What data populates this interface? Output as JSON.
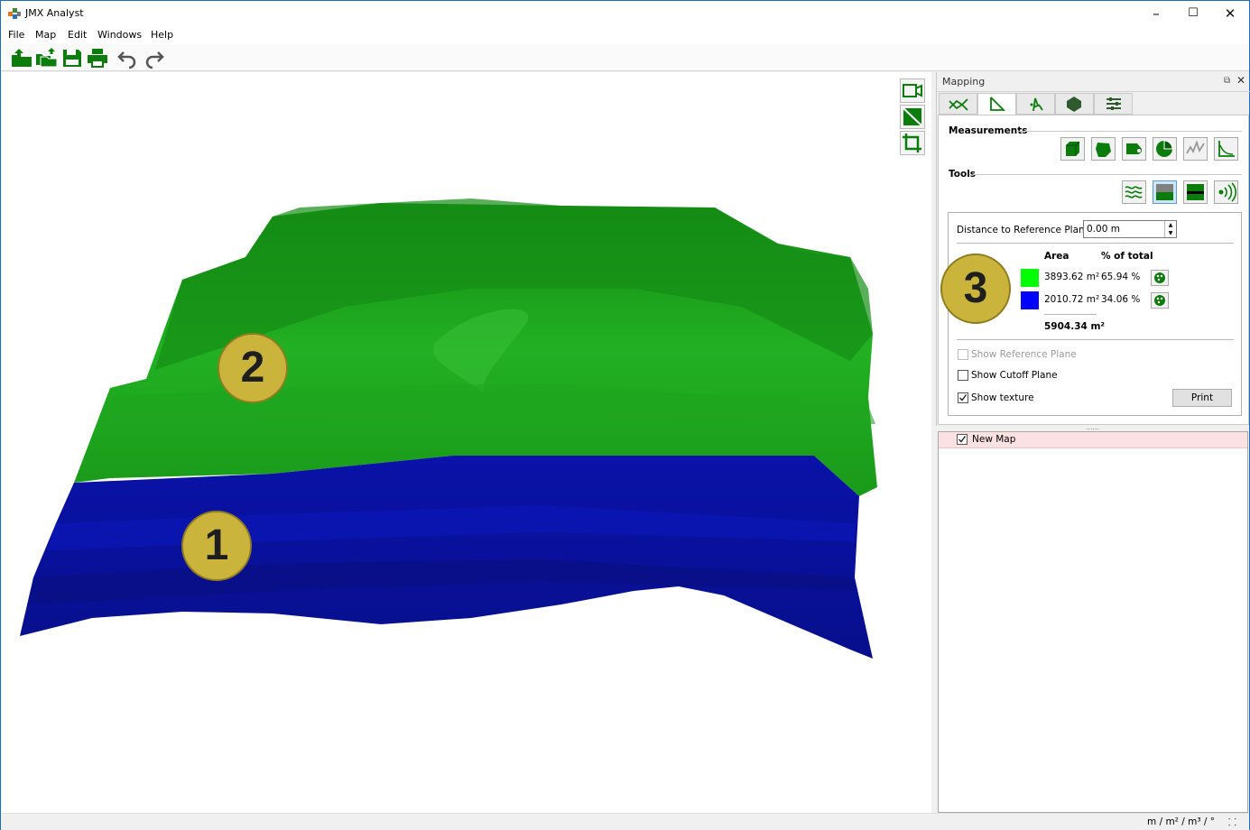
{
  "window": {
    "title": "JMX Analyst"
  },
  "menu": [
    "File",
    "Map",
    "Edit",
    "Windows",
    "Help"
  ],
  "toolbar_icons": [
    "open-folder-icon",
    "open-multiple-icon",
    "save-icon",
    "print-icon",
    "undo-icon",
    "redo-icon"
  ],
  "viewport": {
    "markers": [
      "1",
      "2",
      "3"
    ],
    "colors": {
      "above": "#1fa61f",
      "below": "#0a14b8"
    }
  },
  "mapping_panel": {
    "title": "Mapping",
    "measurements_label": "Measurements",
    "tools_label": "Tools",
    "distance_label": "Distance to Reference Plane:",
    "distance_value": "0.00 m",
    "area_header": "Area",
    "percent_header": "% of total",
    "rows": [
      {
        "color": "#00ff00",
        "area": "3893.62 m²",
        "percent": "65.94 %"
      },
      {
        "color": "#0000ff",
        "area": "2010.72 m²",
        "percent": "34.06 %"
      }
    ],
    "total": "5904.34 m²",
    "show_reference_plane": "Show Reference Plane",
    "show_cutoff_plane": "Show Cutoff Plane",
    "show_texture": "Show texture",
    "print": "Print"
  },
  "layers": {
    "items": [
      {
        "label": "New Map",
        "checked": true
      }
    ]
  },
  "status": {
    "units": "m / m² / m³ / °"
  }
}
